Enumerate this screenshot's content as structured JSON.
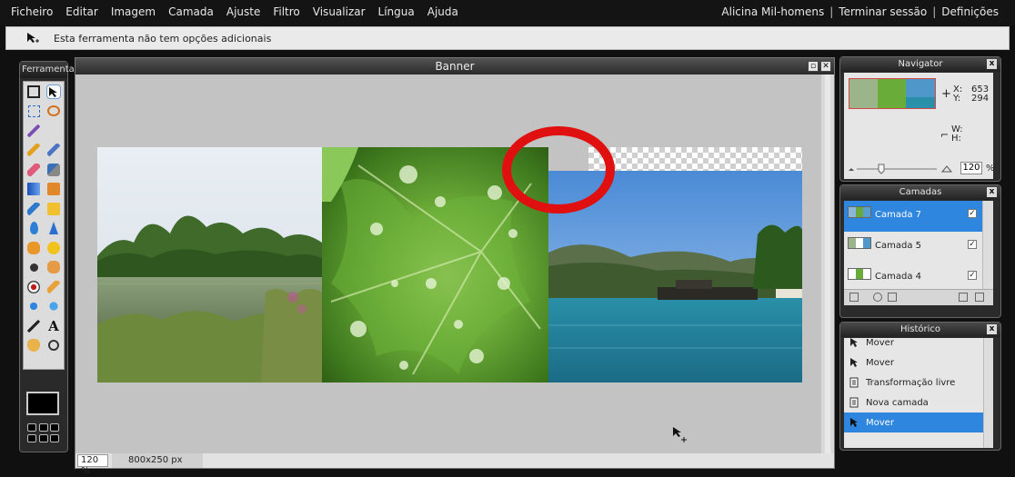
{
  "menu": {
    "items": [
      "Ficheiro",
      "Editar",
      "Imagem",
      "Camada",
      "Ajuste",
      "Filtro",
      "Visualizar",
      "Língua",
      "Ajuda"
    ],
    "user": "Alicina Mil-homens",
    "logout": "Terminar sessão",
    "settings": "Definições",
    "separator": "|"
  },
  "options_bar": {
    "tool_icon": "move-tool-icon",
    "text": "Esta ferramenta não tem opções adicionais"
  },
  "tools_panel": {
    "title": "Ferramentas",
    "tools": [
      "crop-icon",
      "move-icon",
      "marquee-icon",
      "lasso-icon",
      "magic-wand-icon",
      "",
      "pencil-icon",
      "brush-icon",
      "eraser-icon",
      "replace-color-icon",
      "gradient-icon",
      "stamp-icon",
      "color-picker-icon",
      "clone-icon",
      "drop-icon",
      "sharpen-icon",
      "dodge-icon",
      "sponge-icon",
      "zoom-icon",
      "smudge-icon",
      "red-eye-icon",
      "spot-heal-icon",
      "bloat-icon",
      "pinch-icon",
      "draw-line-icon",
      "text-icon",
      "hand-icon",
      "magnify-icon"
    ]
  },
  "document": {
    "title": "Banner",
    "zoom": "120 %",
    "size": "800x250 px"
  },
  "navigator": {
    "title": "Navigator",
    "x_label": "X:",
    "x_value": "653",
    "y_label": "Y:",
    "y_value": "294",
    "w_label": "W:",
    "h_label": "H:",
    "zoom_value": "120",
    "zoom_unit": "%"
  },
  "layers": {
    "title": "Camadas",
    "items": [
      {
        "name": "Camada 7",
        "selected": true
      },
      {
        "name": "Camada 5",
        "selected": false
      },
      {
        "name": "Camada 4",
        "selected": false
      }
    ]
  },
  "history": {
    "title": "Histórico",
    "items": [
      {
        "label": "Mover",
        "icon": "move-icon",
        "selected": false
      },
      {
        "label": "Mover",
        "icon": "move-icon",
        "selected": false
      },
      {
        "label": "Transformação livre",
        "icon": "transform-icon",
        "selected": false
      },
      {
        "label": "Nova camada",
        "icon": "new-layer-icon",
        "selected": false
      },
      {
        "label": "Mover",
        "icon": "move-icon",
        "selected": true
      }
    ]
  },
  "colors": {
    "accent": "#2e86de",
    "highlight_ring": "#e01010"
  }
}
